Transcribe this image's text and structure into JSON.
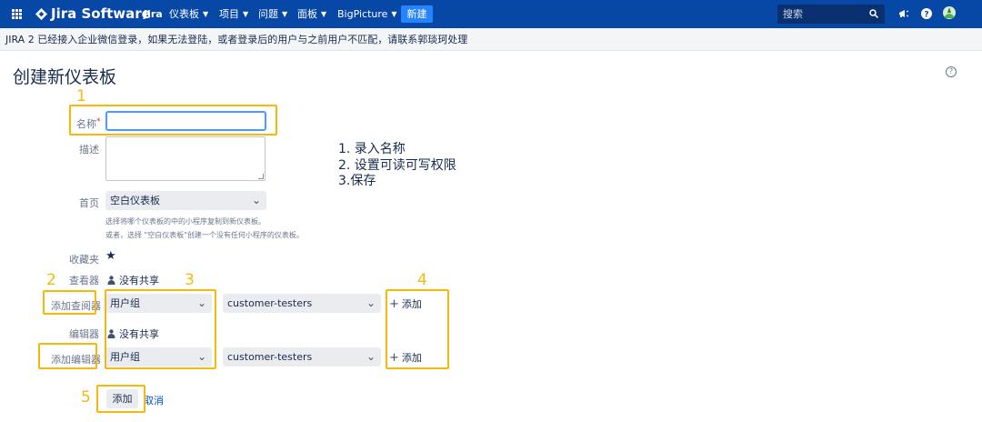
{
  "nav": {
    "brand": "Jira Software",
    "product": "Jira",
    "menus": [
      "仪表板",
      "项目",
      "问题",
      "面板",
      "BigPicture"
    ],
    "create_label": "新建",
    "search_placeholder": "搜索",
    "bg_color": "#0747a6"
  },
  "banner": {
    "text": "JIRA 2 已经接入企业微信登录，如果无法登陆，或者登录后的用户与之前用户不匹配，请联系郭琰珂处理"
  },
  "page": {
    "title": "创建新仪表板"
  },
  "form": {
    "name_label": "名称",
    "required_mark": "*",
    "name_value": "",
    "desc_label": "描述",
    "home_label": "首页",
    "home_value": "空白仪表板",
    "home_hint_1": "选择将哪个仪表板的中的小程序复制到新仪表板。",
    "home_hint_2": "或者，选择 \"空白仪表板\"创建一个没有任何小程序的仪表板。",
    "favorite_label": "收藏夹",
    "viewers_label": "查看器",
    "viewers_value": "没有共享",
    "add_viewer_label": "添加查阅器",
    "viewer_type": "用户组",
    "viewer_group": "customer-testers",
    "viewer_add_label": "添加",
    "editors_label": "编辑器",
    "editors_value": "没有共享",
    "add_editor_label": "添加编辑器",
    "editor_type": "用户组",
    "editor_group": "customer-testers",
    "editor_add_label": "添加",
    "submit_label": "添加",
    "cancel_label": "取消"
  },
  "notes": [
    "1. 录入名称",
    "2. 设置可读可写权限",
    "3.保存"
  ],
  "annotations": [
    "1",
    "2",
    "3",
    "4",
    "5"
  ],
  "highlight_color": "#f6b80a"
}
